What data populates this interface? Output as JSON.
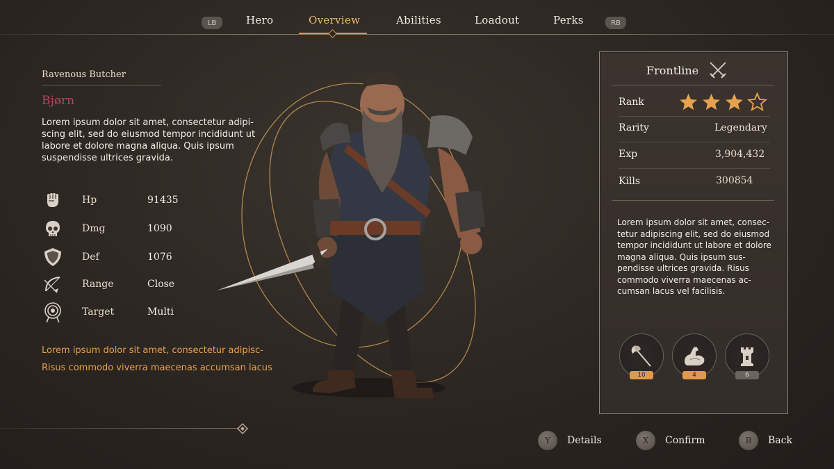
{
  "nav": {
    "lb": "LB",
    "rb": "RB",
    "tabs": [
      {
        "label": "Hero"
      },
      {
        "label": "Overview"
      },
      {
        "label": "Abilities"
      },
      {
        "label": "Loadout"
      },
      {
        "label": "Perks"
      }
    ],
    "active_tab": "Overview"
  },
  "hero": {
    "subtitle": "Ravenous Butcher",
    "name": "Bjørn",
    "description": "Lorem ipsum dolor sit amet, consectetur adipi-scing elit, sed do eiusmod tempor incididunt ut labore et dolore magna aliqua. Quis ipsum suspendisse ultrices gravida.",
    "stats": [
      {
        "icon": "fist-icon",
        "label": "Hp",
        "value": "91435"
      },
      {
        "icon": "skull-icon",
        "label": "Dmg",
        "value": "1090"
      },
      {
        "icon": "shield-icon",
        "label": "Def",
        "value": "1076"
      },
      {
        "icon": "bow-icon",
        "label": "Range",
        "value": "Close"
      },
      {
        "icon": "target-icon",
        "label": "Target",
        "value": "Multi"
      }
    ],
    "notes": [
      "Lorem ipsum dolor sit amet, consectetur adipisc-",
      "Risus commodo viverra maecenas accumsan lacus"
    ]
  },
  "panel": {
    "class_name": "Frontline",
    "class_icon": "crossed-swords-icon",
    "rank_label": "Rank",
    "rank_stars": 3,
    "rank_max": 4,
    "rarity_label": "Rarity",
    "rarity_value": "Legendary",
    "exp_label": "Exp",
    "exp_value": "3,904,432",
    "kills_label": "Kills",
    "kills_value": "300854",
    "description": "Lorem ipsum dolor sit amet, consec-tetur adipiscing elit, sed do eiusmod tempor incididunt ut labore et dolore magna aliqua. Quis ipsum sus-pendisse ultrices gravida. Risus commodo viverra maecenas ac-cumsan lacus vel facilisis.",
    "perks": [
      {
        "icon": "axe-icon",
        "count": "10",
        "badge_color": "#e09a4a"
      },
      {
        "icon": "muscle-icon",
        "count": "4",
        "badge_color": "#e09a4a"
      },
      {
        "icon": "tower-icon",
        "count": "6",
        "badge_color": "#6a645f"
      }
    ]
  },
  "actions": [
    {
      "button": "Y",
      "label": "Details"
    },
    {
      "button": "X",
      "label": "Confirm"
    },
    {
      "button": "B",
      "label": "Back"
    }
  ],
  "colors": {
    "accent": "#d99a48",
    "name": "#b0485a",
    "note": "#e7a14e",
    "background": "#2c2622"
  }
}
